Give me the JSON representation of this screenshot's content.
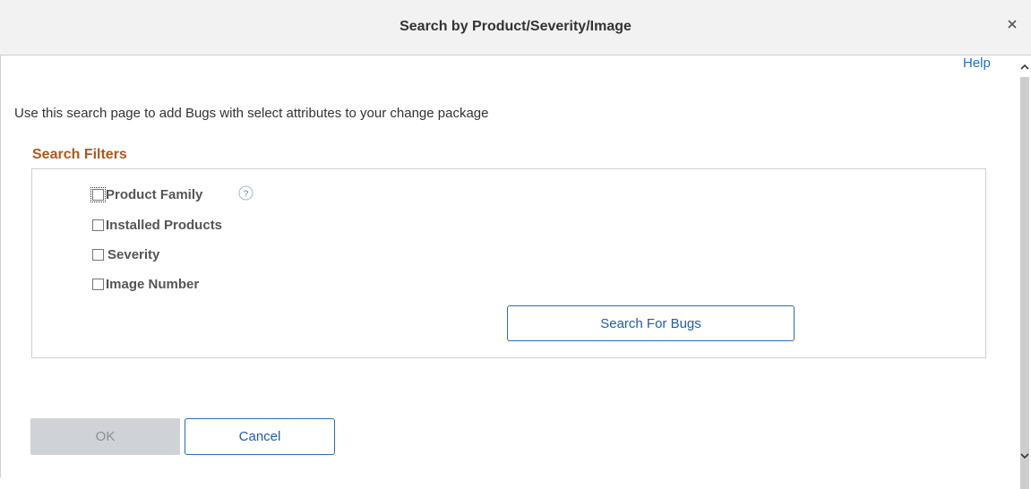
{
  "dialog": {
    "title": "Search by Product/Severity/Image",
    "close_icon": "close-icon"
  },
  "help_link": "Help",
  "intro_text": "Use this search page to add Bugs with select attributes to your change package",
  "search_filters": {
    "heading": "Search Filters",
    "items": [
      {
        "label": "Product Family",
        "checked": false,
        "has_help_icon": true
      },
      {
        "label": "Installed Products",
        "checked": false
      },
      {
        "label": "Severity",
        "checked": false
      },
      {
        "label": "Image Number",
        "checked": false
      }
    ],
    "search_button": "Search For Bugs"
  },
  "footer": {
    "ok_label": "OK",
    "ok_enabled": false,
    "cancel_label": "Cancel"
  },
  "icons": {
    "help_question": "question-mark-icon",
    "scroll_up": "chevron-up-icon",
    "scroll_down": "chevron-down-icon"
  },
  "colors": {
    "section_heading": "#b2561c",
    "link": "#1f6fc5",
    "button_border": "#2b6bb8",
    "disabled_button": "#cfd3d8"
  }
}
